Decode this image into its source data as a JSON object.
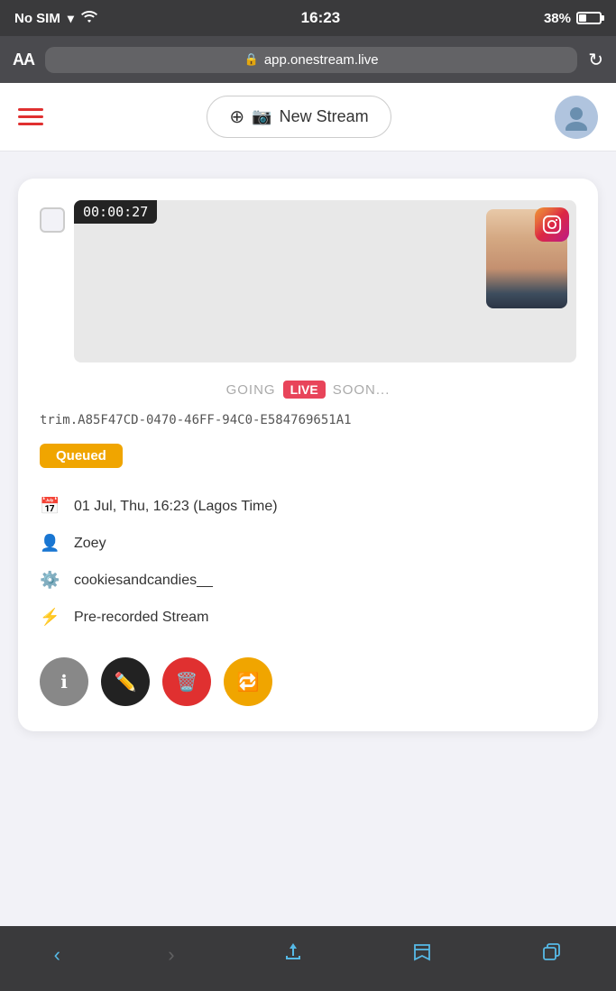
{
  "status_bar": {
    "carrier": "No SIM",
    "time": "16:23",
    "battery_percent": "38%"
  },
  "browser": {
    "aa_label": "AA",
    "url": "app.onestream.live",
    "lock_symbol": "🔒"
  },
  "header": {
    "new_stream_label": "New Stream"
  },
  "stream": {
    "timestamp": "00:00:27",
    "going_live_prefix": "GOING",
    "live_badge": "LIVE",
    "going_live_suffix": "SOON...",
    "stream_id": "trim.A85F47CD-0470-46FF-94C0-E584769651A1",
    "status": "Queued",
    "date": "01 Jul, Thu, 16:23 (Lagos Time)",
    "user": "Zoey",
    "account": "cookiesandcandies__",
    "stream_type": "Pre-recorded Stream"
  },
  "actions": {
    "info_label": "ℹ",
    "edit_label": "✏",
    "delete_label": "🗑",
    "repost_label": "↺"
  },
  "bottom_nav": {
    "back": "‹",
    "forward": "›",
    "share": "⬆",
    "bookmarks": "📖",
    "tabs": "⧉"
  }
}
